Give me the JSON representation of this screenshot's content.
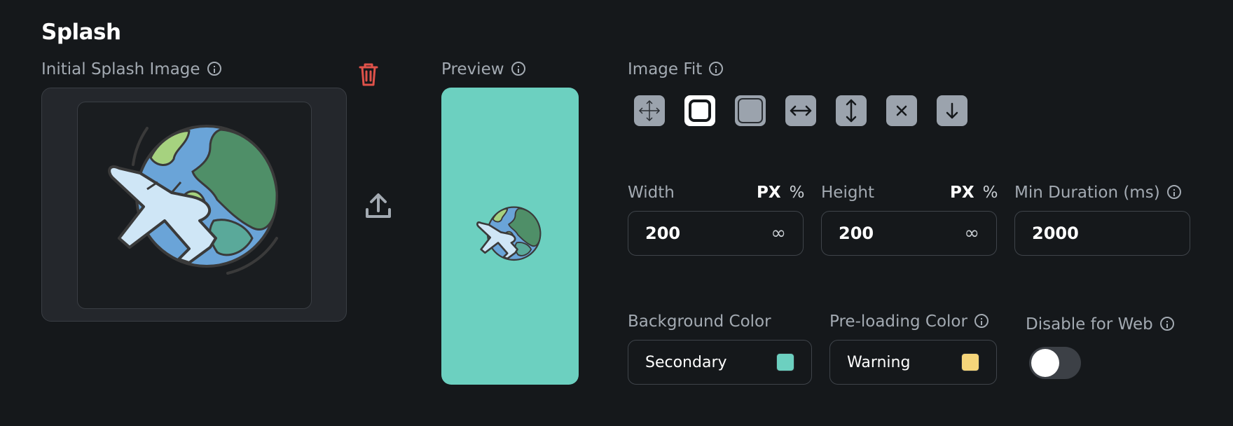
{
  "section": {
    "title": "Splash"
  },
  "initial_image": {
    "label": "Initial Splash Image"
  },
  "preview": {
    "label": "Preview"
  },
  "image_fit": {
    "label": "Image Fit",
    "options": [
      "fill",
      "contain",
      "cover",
      "fit-width",
      "fit-height",
      "none",
      "scale-down"
    ],
    "selected": "contain"
  },
  "width": {
    "label": "Width",
    "unit_px": "PX",
    "unit_pct": "%",
    "value": "200",
    "infinity": "∞"
  },
  "height": {
    "label": "Height",
    "unit_px": "PX",
    "unit_pct": "%",
    "value": "200",
    "infinity": "∞"
  },
  "min_duration": {
    "label": "Min Duration (ms)",
    "value": "2000"
  },
  "background_color": {
    "label": "Background Color",
    "value": "Secondary",
    "swatch": "#6cd0c0"
  },
  "preloading_color": {
    "label": "Pre-loading Color",
    "value": "Warning",
    "swatch": "#f5d57a"
  },
  "disable_web": {
    "label": "Disable for Web",
    "enabled": false
  },
  "colors": {
    "background": "#15181b",
    "delete": "#e0524a",
    "preview_bg": "#6cd0c0"
  }
}
